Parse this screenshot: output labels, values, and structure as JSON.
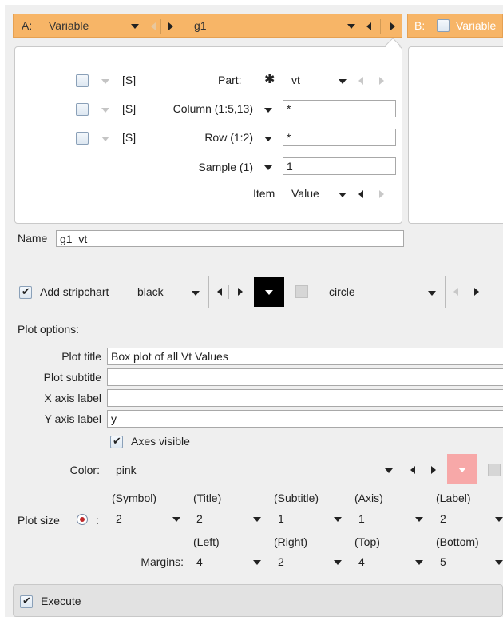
{
  "tabs": {
    "a_prefix": "A:",
    "a_label": "Variable",
    "a_value": "g1",
    "b_prefix": "B:",
    "b_label": "Variable"
  },
  "selectors": {
    "s_label": "[S]",
    "part_label": "Part:",
    "part_value": "vt",
    "column_label": "Column (1:5,13)",
    "column_value": "*",
    "row_label": "Row (1:2)",
    "row_value": "*",
    "sample_label": "Sample (1)",
    "sample_value": "1",
    "item_label": "Item",
    "item_value": "Value"
  },
  "name": {
    "label": "Name",
    "value": "g1_vt"
  },
  "stripchart": {
    "label": "Add stripchart",
    "checked": true,
    "color": "black",
    "color_swatch": "#000000",
    "symbol": "circle"
  },
  "plot_options": {
    "header": "Plot options:",
    "title_label": "Plot title",
    "title_value": "Box plot of all Vt Values",
    "subtitle_label": "Plot subtitle",
    "subtitle_value": "",
    "xaxis_label": "X axis label",
    "xaxis_value": "",
    "yaxis_label": "Y axis label",
    "yaxis_value": "y",
    "axes_visible_label": "Axes visible",
    "axes_visible": true,
    "color_label": "Color:",
    "color_value": "pink",
    "color_swatch": "#f7a8a8"
  },
  "plot_size": {
    "label": "Plot size",
    "colon": ":",
    "headers": [
      "(Symbol)",
      "(Title)",
      "(Subtitle)",
      "(Axis)",
      "(Label)"
    ],
    "values": [
      "2",
      "2",
      "1",
      "1",
      "2"
    ]
  },
  "margins": {
    "label": "Margins:",
    "headers": [
      "(Left)",
      "(Right)",
      "(Top)",
      "(Bottom)"
    ],
    "values": [
      "4",
      "2",
      "4",
      "5"
    ]
  },
  "execute": {
    "label": "Execute",
    "checked": true
  }
}
